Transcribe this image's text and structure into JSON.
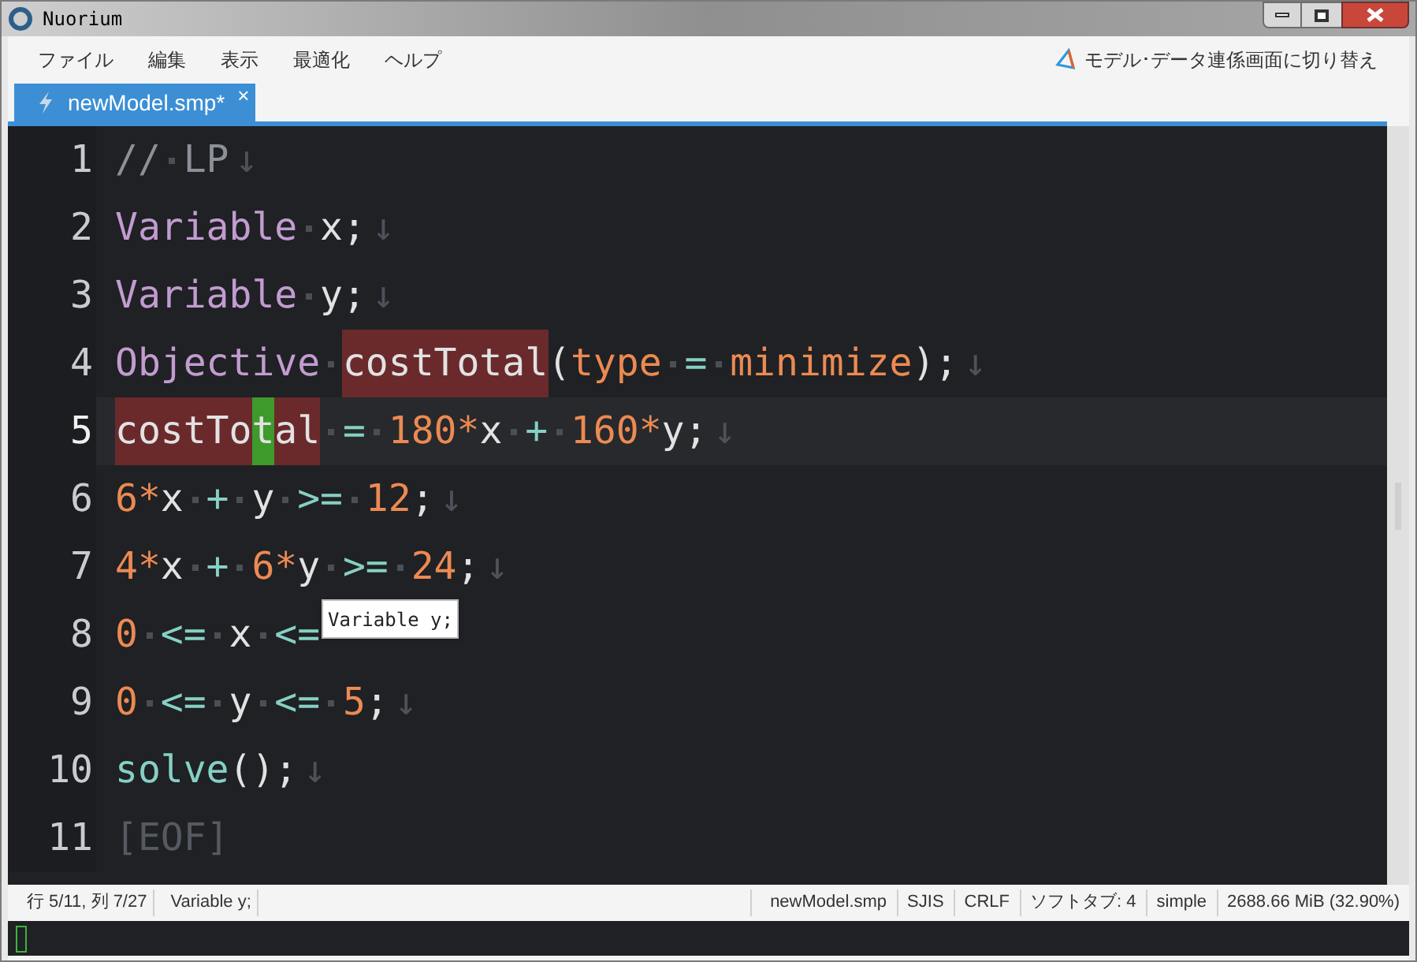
{
  "window": {
    "title": "Nuorium"
  },
  "menu": [
    "ファイル",
    "編集",
    "表示",
    "最適化",
    "ヘルプ"
  ],
  "switch_button": {
    "label": "モデル･データ連係画面に切り替え"
  },
  "tabs": [
    {
      "label": "newModel.smp*",
      "selected": true,
      "close": "×"
    }
  ],
  "lines": [
    {
      "number": "1",
      "current": false,
      "eol": "↓",
      "tokens": [
        {
          "kind": "comment",
          "text": "//"
        },
        {
          "kind": "space"
        },
        {
          "kind": "comment",
          "text": "LP"
        }
      ]
    },
    {
      "number": "2",
      "current": false,
      "eol": "↓",
      "tokens": [
        {
          "kind": "keyword",
          "text": "Variable"
        },
        {
          "kind": "space"
        },
        {
          "kind": "ident",
          "text": "x;"
        }
      ]
    },
    {
      "number": "3",
      "current": false,
      "eol": "↓",
      "tokens": [
        {
          "kind": "keyword",
          "text": "Variable"
        },
        {
          "kind": "space"
        },
        {
          "kind": "ident",
          "text": "y;"
        }
      ]
    },
    {
      "number": "4",
      "current": false,
      "eol": "↓",
      "tokens": [
        {
          "kind": "keyword",
          "text": "Objective"
        },
        {
          "kind": "space"
        },
        {
          "kind": "ident",
          "text": "costTotal",
          "highlighted": true
        },
        {
          "kind": "ident",
          "text": "("
        },
        {
          "kind": "number",
          "text": "type"
        },
        {
          "kind": "space"
        },
        {
          "kind": "op",
          "text": "="
        },
        {
          "kind": "space"
        },
        {
          "kind": "number",
          "text": "minimize"
        },
        {
          "kind": "ident",
          "text": ");"
        }
      ]
    },
    {
      "number": "5",
      "current": true,
      "eol": "↓",
      "tokens": [
        {
          "kind": "ident",
          "text": "costTo",
          "highlighted": true
        },
        {
          "kind": "cursor",
          "text": "t"
        },
        {
          "kind": "ident",
          "text": "al",
          "highlighted": true
        },
        {
          "kind": "space"
        },
        {
          "kind": "op",
          "text": "="
        },
        {
          "kind": "space"
        },
        {
          "kind": "number",
          "text": "180*"
        },
        {
          "kind": "ident",
          "text": "x"
        },
        {
          "kind": "space"
        },
        {
          "kind": "op",
          "text": "+"
        },
        {
          "kind": "space"
        },
        {
          "kind": "number",
          "text": "160*"
        },
        {
          "kind": "ident",
          "text": "y;"
        }
      ]
    },
    {
      "number": "6",
      "current": false,
      "eol": "↓",
      "tokens": [
        {
          "kind": "number",
          "text": "6*"
        },
        {
          "kind": "ident",
          "text": "x"
        },
        {
          "kind": "space"
        },
        {
          "kind": "op",
          "text": "+"
        },
        {
          "kind": "space"
        },
        {
          "kind": "ident",
          "text": "y"
        },
        {
          "kind": "space"
        },
        {
          "kind": "op",
          "text": ">="
        },
        {
          "kind": "space"
        },
        {
          "kind": "number",
          "text": "12"
        },
        {
          "kind": "ident",
          "text": ";"
        }
      ]
    },
    {
      "number": "7",
      "current": false,
      "eol": "↓",
      "tokens": [
        {
          "kind": "number",
          "text": "4*"
        },
        {
          "kind": "ident",
          "text": "x"
        },
        {
          "kind": "space"
        },
        {
          "kind": "op",
          "text": "+"
        },
        {
          "kind": "space"
        },
        {
          "kind": "number",
          "text": "6*"
        },
        {
          "kind": "ident",
          "text": "y"
        },
        {
          "kind": "space"
        },
        {
          "kind": "op",
          "text": ">="
        },
        {
          "kind": "space"
        },
        {
          "kind": "number",
          "text": "24"
        },
        {
          "kind": "ident",
          "text": ";"
        }
      ]
    },
    {
      "number": "8",
      "current": false,
      "tokens": [
        {
          "kind": "number",
          "text": "0"
        },
        {
          "kind": "space"
        },
        {
          "kind": "op",
          "text": "<="
        },
        {
          "kind": "space"
        },
        {
          "kind": "ident",
          "text": "x"
        },
        {
          "kind": "space"
        },
        {
          "kind": "op",
          "text": "<="
        }
      ]
    },
    {
      "number": "9",
      "current": false,
      "eol": "↓",
      "tokens": [
        {
          "kind": "number",
          "text": "0"
        },
        {
          "kind": "space"
        },
        {
          "kind": "op",
          "text": "<="
        },
        {
          "kind": "space"
        },
        {
          "kind": "ident",
          "text": "y"
        },
        {
          "kind": "space"
        },
        {
          "kind": "op",
          "text": "<="
        },
        {
          "kind": "space"
        },
        {
          "kind": "number",
          "text": "5"
        },
        {
          "kind": "ident",
          "text": ";"
        }
      ]
    },
    {
      "number": "10",
      "current": false,
      "eol": "↓",
      "tokens": [
        {
          "kind": "op",
          "text": "solve"
        },
        {
          "kind": "ident",
          "text": "();"
        }
      ]
    },
    {
      "number": "11",
      "current": false,
      "tokens": [
        {
          "kind": "eof",
          "text": "[EOF]"
        }
      ]
    }
  ],
  "tooltip": {
    "text": "Variable y;"
  },
  "status_bar": {
    "left": [
      "行 5/11, 列 7/27",
      "Variable y;"
    ],
    "right": [
      "newModel.smp",
      "SJIS",
      "CRLF",
      "ソフトタブ: 4",
      "simple",
      "2688.66 MiB (32.90%)"
    ]
  }
}
